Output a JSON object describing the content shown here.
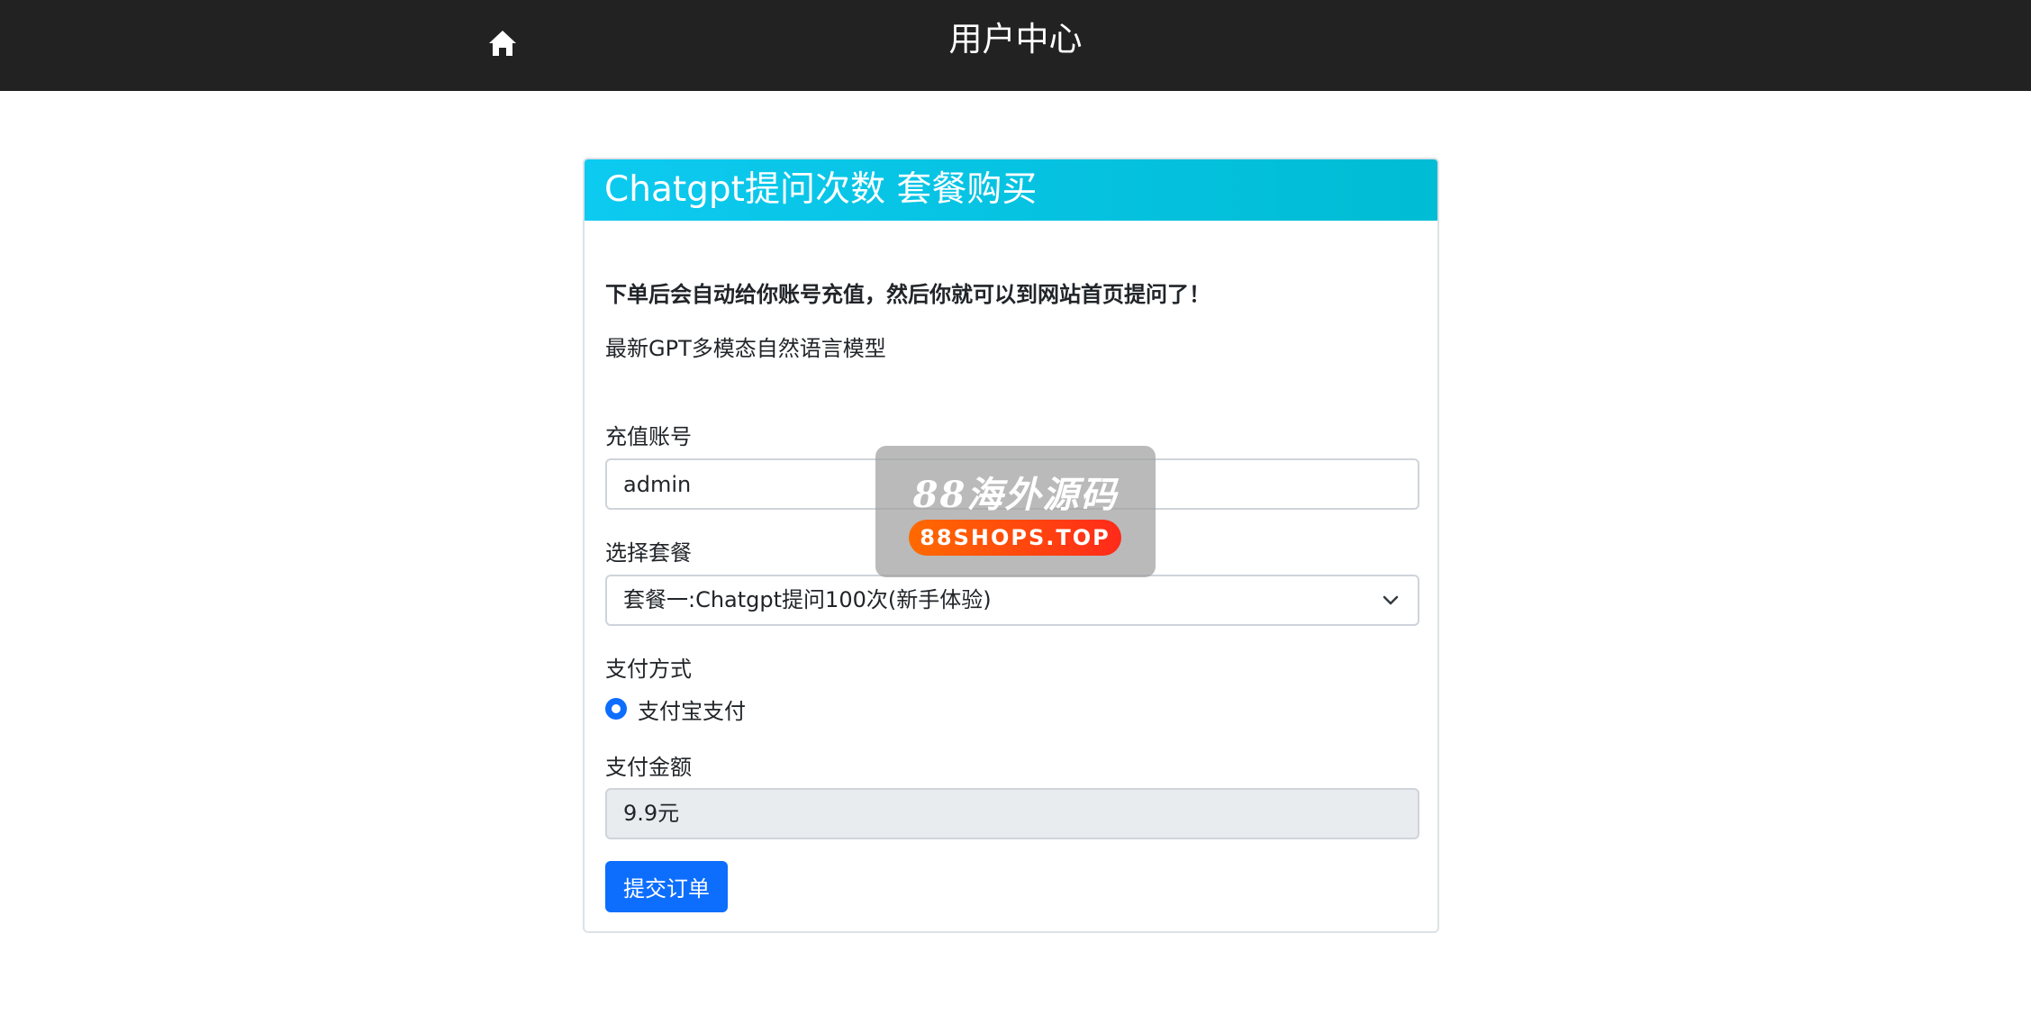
{
  "header": {
    "home_icon": "home-icon",
    "title": "用户中心"
  },
  "card": {
    "title": "Chatgpt提问次数 套餐购买",
    "notice": "下单后会自动给你账号充值，然后你就可以到网站首页提问了！",
    "description": "最新GPT多模态自然语言模型"
  },
  "form": {
    "account_label": "充值账号",
    "account_value": "admin",
    "package_label": "选择套餐",
    "package_selected": "套餐一:Chatgpt提问100次(新手体验)",
    "payment_label": "支付方式",
    "payment_option": "支付宝支付",
    "payment_selected": true,
    "amount_label": "支付金额",
    "amount_value": "9.9元",
    "submit_label": "提交订单"
  },
  "watermark": {
    "title": "88海外源码",
    "subtitle": "88SHOPS.TOP"
  },
  "colors": {
    "topbar": "#222222",
    "header_gradient_start": "#0dcaf0",
    "header_gradient_end": "#00bcd4",
    "primary": "#0d6efd",
    "readonly_bg": "#e9ecef"
  }
}
